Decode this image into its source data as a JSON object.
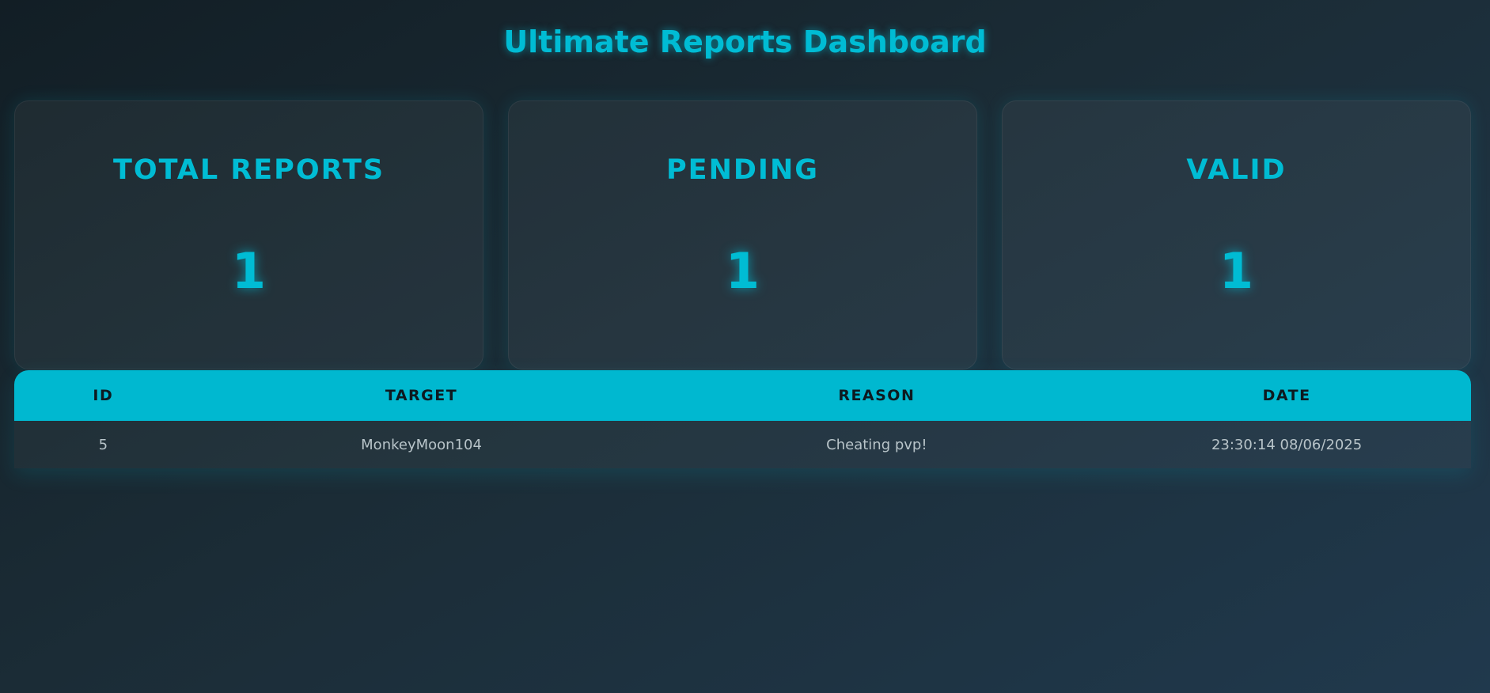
{
  "header": {
    "title": "Ultimate Reports Dashboard"
  },
  "stats": [
    {
      "label": "TOTAL REPORTS",
      "value": "1"
    },
    {
      "label": "PENDING",
      "value": "1"
    },
    {
      "label": "VALID",
      "value": "1"
    }
  ],
  "table": {
    "columns": [
      "ID",
      "TARGET",
      "REASON",
      "DATE"
    ],
    "rows": [
      [
        "5",
        "MonkeyMoon104",
        "Cheating pvp!",
        "23:30:14 08/06/2025"
      ]
    ]
  },
  "colors": {
    "accent": "#00bcd4",
    "header_bg": "#00b8d0",
    "background": "#1b2c36"
  }
}
